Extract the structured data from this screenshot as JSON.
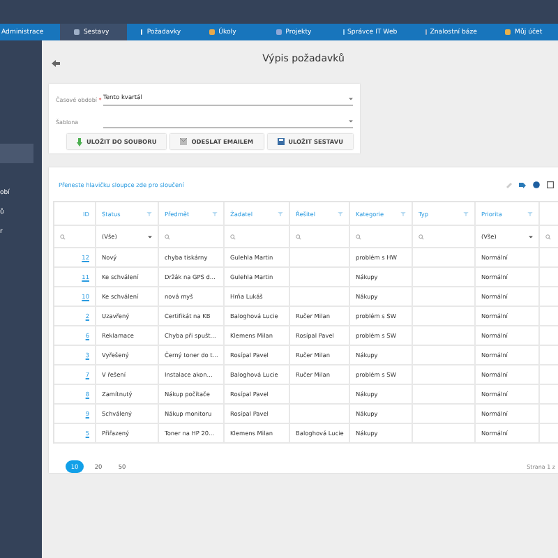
{
  "nav": [
    {
      "label": "Administrace",
      "selected": false
    },
    {
      "label": "Sestavy",
      "selected": true
    },
    {
      "label": "Požadavky",
      "selected": false
    },
    {
      "label": "Úkoly",
      "selected": false
    },
    {
      "label": "Projekty",
      "selected": false
    },
    {
      "label": "Správce IT Web",
      "selected": false
    },
    {
      "label": "Znalostní báze",
      "selected": false
    },
    {
      "label": "Můj účet",
      "selected": false
    }
  ],
  "sidebar": {
    "items": [
      {
        "selected": true
      },
      {
        "label": "obí",
        "selected": false
      },
      {
        "label": "ů",
        "selected": false
      },
      {
        "label": "r",
        "selected": false
      }
    ]
  },
  "page_title": "Výpis požadavků",
  "form": {
    "fields": [
      {
        "label": "Časové období",
        "required_mark": "*",
        "value": "Tento kvartál"
      },
      {
        "label": "Šablona"
      }
    ],
    "buttons": [
      "ULOŽIT DO SOUBORU",
      "ODESLAT EMAILEM",
      "ULOŽIT SESTAVU"
    ]
  },
  "grid": {
    "group_hint": "Přeneste hlavičku sloupce zde pro sloučení",
    "columns": [
      "ID",
      "Status",
      "Předmět",
      "Žadatel",
      "Řešitel",
      "Kategorie",
      "Typ",
      "Priorita"
    ],
    "filters": [
      {
        "kind": "search"
      },
      {
        "kind": "select",
        "value": "(Vše)"
      },
      {
        "kind": "search"
      },
      {
        "kind": "search"
      },
      {
        "kind": "search"
      },
      {
        "kind": "search"
      },
      {
        "kind": "search"
      },
      {
        "kind": "select",
        "value": "(Vše)"
      },
      {
        "kind": "search"
      }
    ],
    "rows": [
      [
        "12",
        "Nový",
        "chyba tiskárny",
        "Gulehla Martin",
        "",
        "problém s HW",
        "",
        "Normální"
      ],
      [
        "11",
        "Ke schválení",
        "Držák na GPS d...",
        "Gulehla Martin",
        "",
        "Nákupy",
        "",
        "Normální"
      ],
      [
        "10",
        "Ke schválení",
        "nová myš",
        "Hrňa Lukáš",
        "",
        "Nákupy",
        "",
        "Normální"
      ],
      [
        "2",
        "Uzavřený",
        "Certifikát na KB",
        "Baloghová Lucie",
        "Ručer Milan",
        "problém s SW",
        "",
        "Normální"
      ],
      [
        "6",
        "Reklamace",
        "Chyba při spušt...",
        "Klemens Milan",
        "Rosípal Pavel",
        "problém s SW",
        "",
        "Normální"
      ],
      [
        "3",
        "Vyřešený",
        "Černý toner do t...",
        "Rosípal Pavel",
        "Ručer Milan",
        "Nákupy",
        "",
        "Normální"
      ],
      [
        "7",
        "V řešení",
        "Instalace akon...",
        "Baloghová Lucie",
        "Ručer Milan",
        "problém s SW",
        "",
        "Normální"
      ],
      [
        "8",
        "Zamítnutý",
        "Nákup počítače",
        "Rosípal Pavel",
        "",
        "Nákupy",
        "",
        "Normální"
      ],
      [
        "9",
        "Schválený",
        "Nákup monitoru",
        "Rosípal Pavel",
        "",
        "Nákupy",
        "",
        "Normální"
      ],
      [
        "5",
        "Přiřazený",
        "Toner na HP 20...",
        "Klemens Milan",
        "Baloghová Lucie",
        "Nákupy",
        "",
        "Normální"
      ]
    ],
    "page_sizes": [
      {
        "label": "10",
        "selected": true
      },
      {
        "label": "20",
        "selected": false
      },
      {
        "label": "50",
        "selected": false
      }
    ],
    "page_info": "Strana 1 z"
  }
}
